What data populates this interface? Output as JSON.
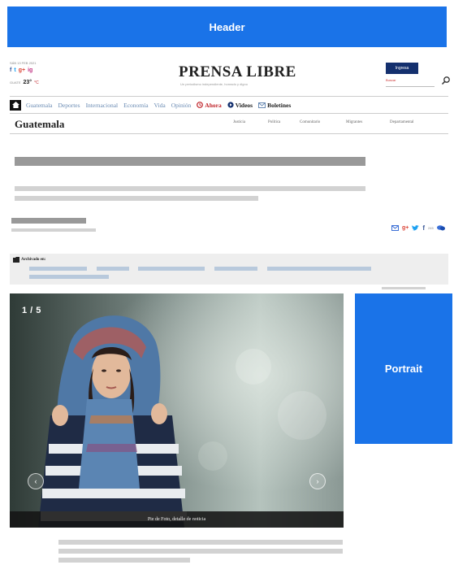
{
  "header_ad": {
    "label": "Header"
  },
  "portrait_ad": {
    "label": "Portrait"
  },
  "top_left": {
    "date": "SÁB 13 FEB 2021",
    "weather_city": "GUATE",
    "temperature": "23°",
    "unit": "°C",
    "social": [
      "f",
      "t",
      "g+",
      "ig"
    ]
  },
  "site": {
    "logo": "PRENSA LIBRE",
    "tagline": "Un periodismo independiente, honrado y digno",
    "login_label": "Ingresa",
    "search_placeholder": "Buscar"
  },
  "nav": {
    "items": [
      "Guatemala",
      "Deportes",
      "Internacional",
      "Economía",
      "Vida",
      "Opinión"
    ],
    "ahora": "Ahora",
    "videos": "Videos",
    "boletines": "Boletines"
  },
  "section": {
    "title": "Guatemala",
    "subnav": [
      "Justicia",
      "Política",
      "Comunitario",
      "Migrantes",
      "Departamental"
    ]
  },
  "archive": {
    "label": "Archivado en:"
  },
  "share": {
    "count": "245"
  },
  "gallery": {
    "counter": "1 / 5",
    "caption": "Pie de Foto, detalle de noticia"
  },
  "colors": {
    "ad_blue": "#1a73e8",
    "brand_navy": "#14306e",
    "alert_red": "#c0252b",
    "link_blue": "#6a8bb3"
  }
}
